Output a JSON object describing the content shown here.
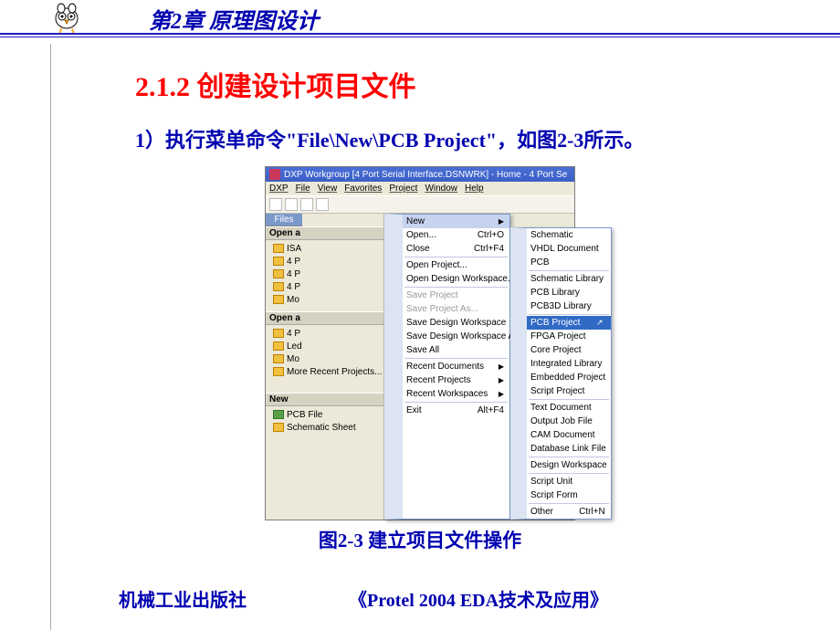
{
  "chapter_header": "第2章  原理图设计",
  "section_title": "2.1.2  创建设计项目文件",
  "step_text": "1）执行菜单命令\"File\\New\\PCB Project\"，如图2-3所示。",
  "screenshot": {
    "title_prefix": "DXP Workgroup [4 Port Serial Interface.DSNWRK] - Home - 4 Port Se",
    "menubar": [
      "DXP",
      "File",
      "View",
      "Favorites",
      "Project",
      "Window",
      "Help"
    ],
    "files_tab": "Files",
    "panels": {
      "open_doc_hdr": "Open a",
      "open_doc_items": [
        "ISA",
        "4 P",
        "4 P",
        "4 P",
        "Mo"
      ],
      "open_proj_hdr": "Open a",
      "open_proj_items": [
        "4 P",
        "Led",
        "Mo"
      ],
      "more_recent": "More Recent Projects...",
      "new_hdr": "New",
      "new_items": [
        "PCB File",
        "Schematic Sheet"
      ]
    },
    "file_menu": {
      "new": "New",
      "open": "Open...",
      "open_sc": "Ctrl+O",
      "close": "Close",
      "close_sc": "Ctrl+F4",
      "open_project": "Open Project...",
      "open_workspace": "Open Design Workspace...",
      "save_project": "Save Project",
      "save_project_as": "Save Project As...",
      "save_ws": "Save Design Workspace",
      "save_ws_as": "Save Design Workspace As...",
      "save_all": "Save All",
      "recent_docs": "Recent Documents",
      "recent_projects": "Recent Projects",
      "recent_ws": "Recent Workspaces",
      "exit": "Exit",
      "exit_sc": "Alt+F4"
    },
    "submenu": {
      "schematic": "Schematic",
      "vhdl": "VHDL Document",
      "pcb": "PCB",
      "sch_lib": "Schematic Library",
      "pcb_lib": "PCB Library",
      "pcb3d": "PCB3D Library",
      "pcb_project": "PCB Project",
      "fpga": "FPGA Project",
      "core": "Core Project",
      "int_lib": "Integrated Library",
      "embedded": "Embedded Project",
      "script_proj": "Script Project",
      "text_doc": "Text Document",
      "output_job": "Output Job File",
      "cam": "CAM Document",
      "db_link": "Database Link File",
      "design_ws": "Design Workspace",
      "script_unit": "Script Unit",
      "script_form": "Script Form",
      "other": "Other",
      "other_sc": "Ctrl+N"
    }
  },
  "caption": "图2-3  建立项目文件操作",
  "footer": {
    "publisher": "机械工业出版社",
    "book": "《Protel 2004 EDA技术及应用》"
  }
}
